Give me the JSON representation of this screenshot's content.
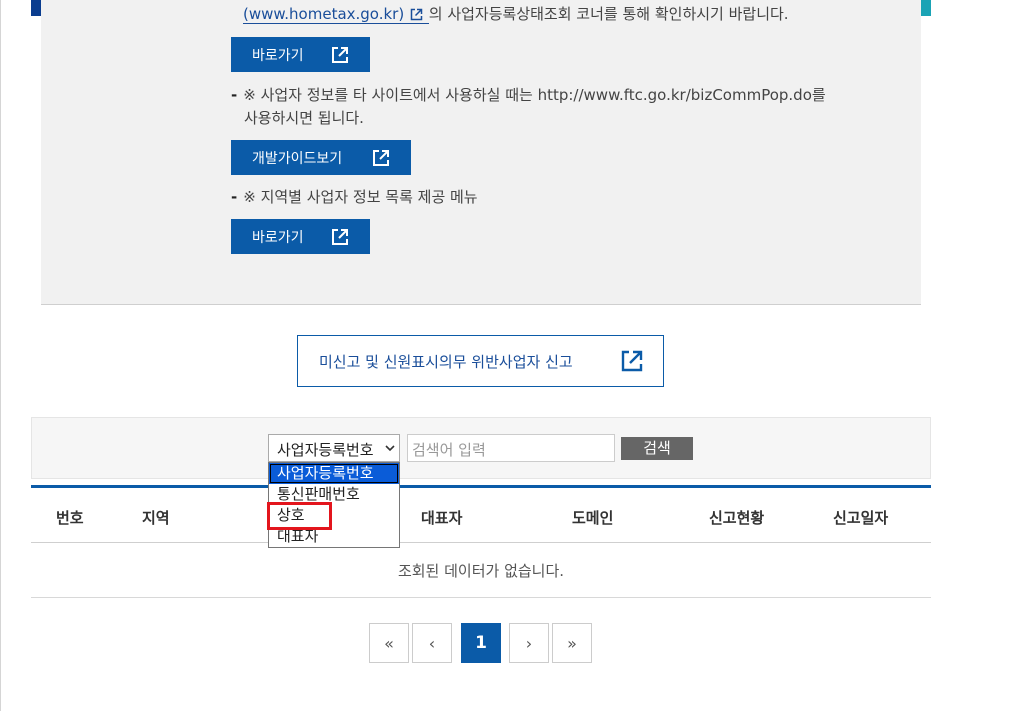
{
  "info": {
    "hometax_url": "(www.hometax.go.kr)",
    "hometax_suffix": "의 사업자등록상태조회 코너를 통해 확인하시기 바랍니다.",
    "bullet_dash": "-",
    "notice1_line1": "※ 사업자 정보를 타 사이트에서 사용하실 때는 http://www.ftc.go.kr/bizCommPop.do를",
    "notice1_line2": "사용하시면 됩니다.",
    "notice2": "※ 지역별 사업자 정보 목록 제공 메뉴",
    "goto_label_1": "바로가기",
    "dev_guide_label": "개발가이드보기",
    "goto_label_2": "바로가기"
  },
  "report_button": {
    "label": "미신고 및 신원표시의무 위반사업자 신고"
  },
  "search": {
    "selected": "사업자등록번호",
    "placeholder": "검색어 입력",
    "button_label": "검색",
    "options": [
      "사업자등록번호",
      "통신판매번호",
      "상호",
      "대표자"
    ]
  },
  "table": {
    "columns": [
      "번호",
      "지역",
      "대표자",
      "도메인",
      "신고현황",
      "신고일자"
    ],
    "empty_message": "조회된 데이터가 없습니다."
  },
  "pagination": {
    "first": "«",
    "prev": "‹",
    "current": "1",
    "next": "›",
    "last": "»"
  },
  "colors": {
    "primary_blue": "#0b5ba8",
    "highlight_red": "#e3151d",
    "dropdown_selected": "#0a5cd8"
  }
}
